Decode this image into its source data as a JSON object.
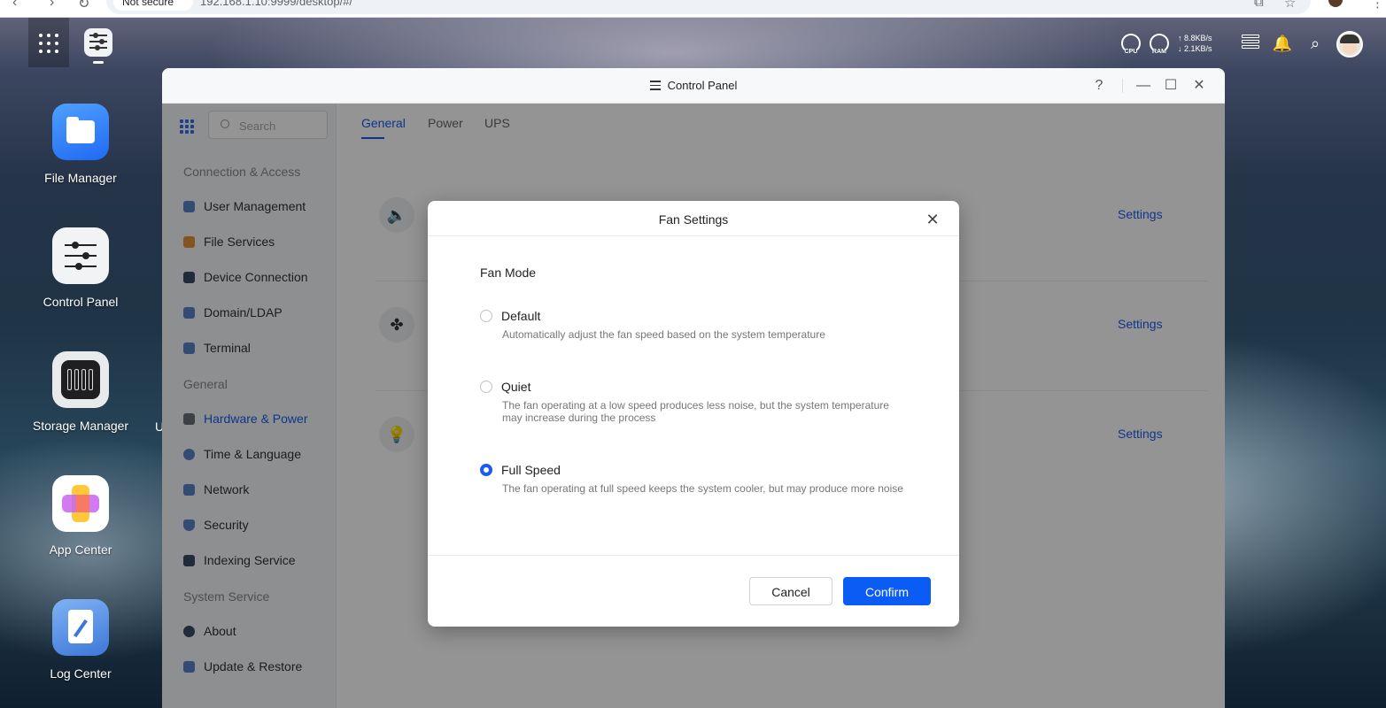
{
  "browser": {
    "chip_label": "Not secure",
    "url": "192.168.1.10:9999/desktop/#/"
  },
  "desktop": {
    "icons": [
      {
        "label": "File Manager"
      },
      {
        "label": "Control Panel"
      },
      {
        "label": "Storage Manager"
      },
      {
        "label": "App Center"
      },
      {
        "label": "Log Center"
      }
    ],
    "partial_label": "U"
  },
  "tray": {
    "cpu_label": "CPU",
    "ram_label": "RAM",
    "upload": "↑ 8.8KB/s",
    "download": "↓ 2.1KB/s"
  },
  "control_panel": {
    "title": "Control Panel",
    "help_glyph": "?",
    "search_placeholder": "Search",
    "sections": {
      "connection": "Connection & Access",
      "general": "General",
      "system": "System Service"
    },
    "items": [
      "User Management",
      "File Services",
      "Device Connection",
      "Domain/LDAP",
      "Terminal",
      "Hardware & Power",
      "Time & Language",
      "Network",
      "Security",
      "Indexing Service",
      "About",
      "Update & Restore"
    ],
    "active_item": "Hardware & Power",
    "tabs": [
      "General",
      "Power",
      "UPS"
    ],
    "active_tab": "General",
    "settings_link": "Settings",
    "colors": {
      "accent": "#1b5bf0"
    }
  },
  "modal": {
    "title": "Fan Settings",
    "section_label": "Fan Mode",
    "options": [
      {
        "title": "Default",
        "desc": "Automatically adjust the fan speed based on the system temperature",
        "checked": false
      },
      {
        "title": "Quiet",
        "desc": "The fan operating at a low speed produces less noise, but the system temperature may increase during the process",
        "checked": false
      },
      {
        "title": "Full Speed",
        "desc": "The fan operating at full speed keeps the system cooler, but may produce more noise",
        "checked": true
      }
    ],
    "cancel_label": "Cancel",
    "confirm_label": "Confirm",
    "colors": {
      "confirm": "#0a5cf5"
    }
  }
}
